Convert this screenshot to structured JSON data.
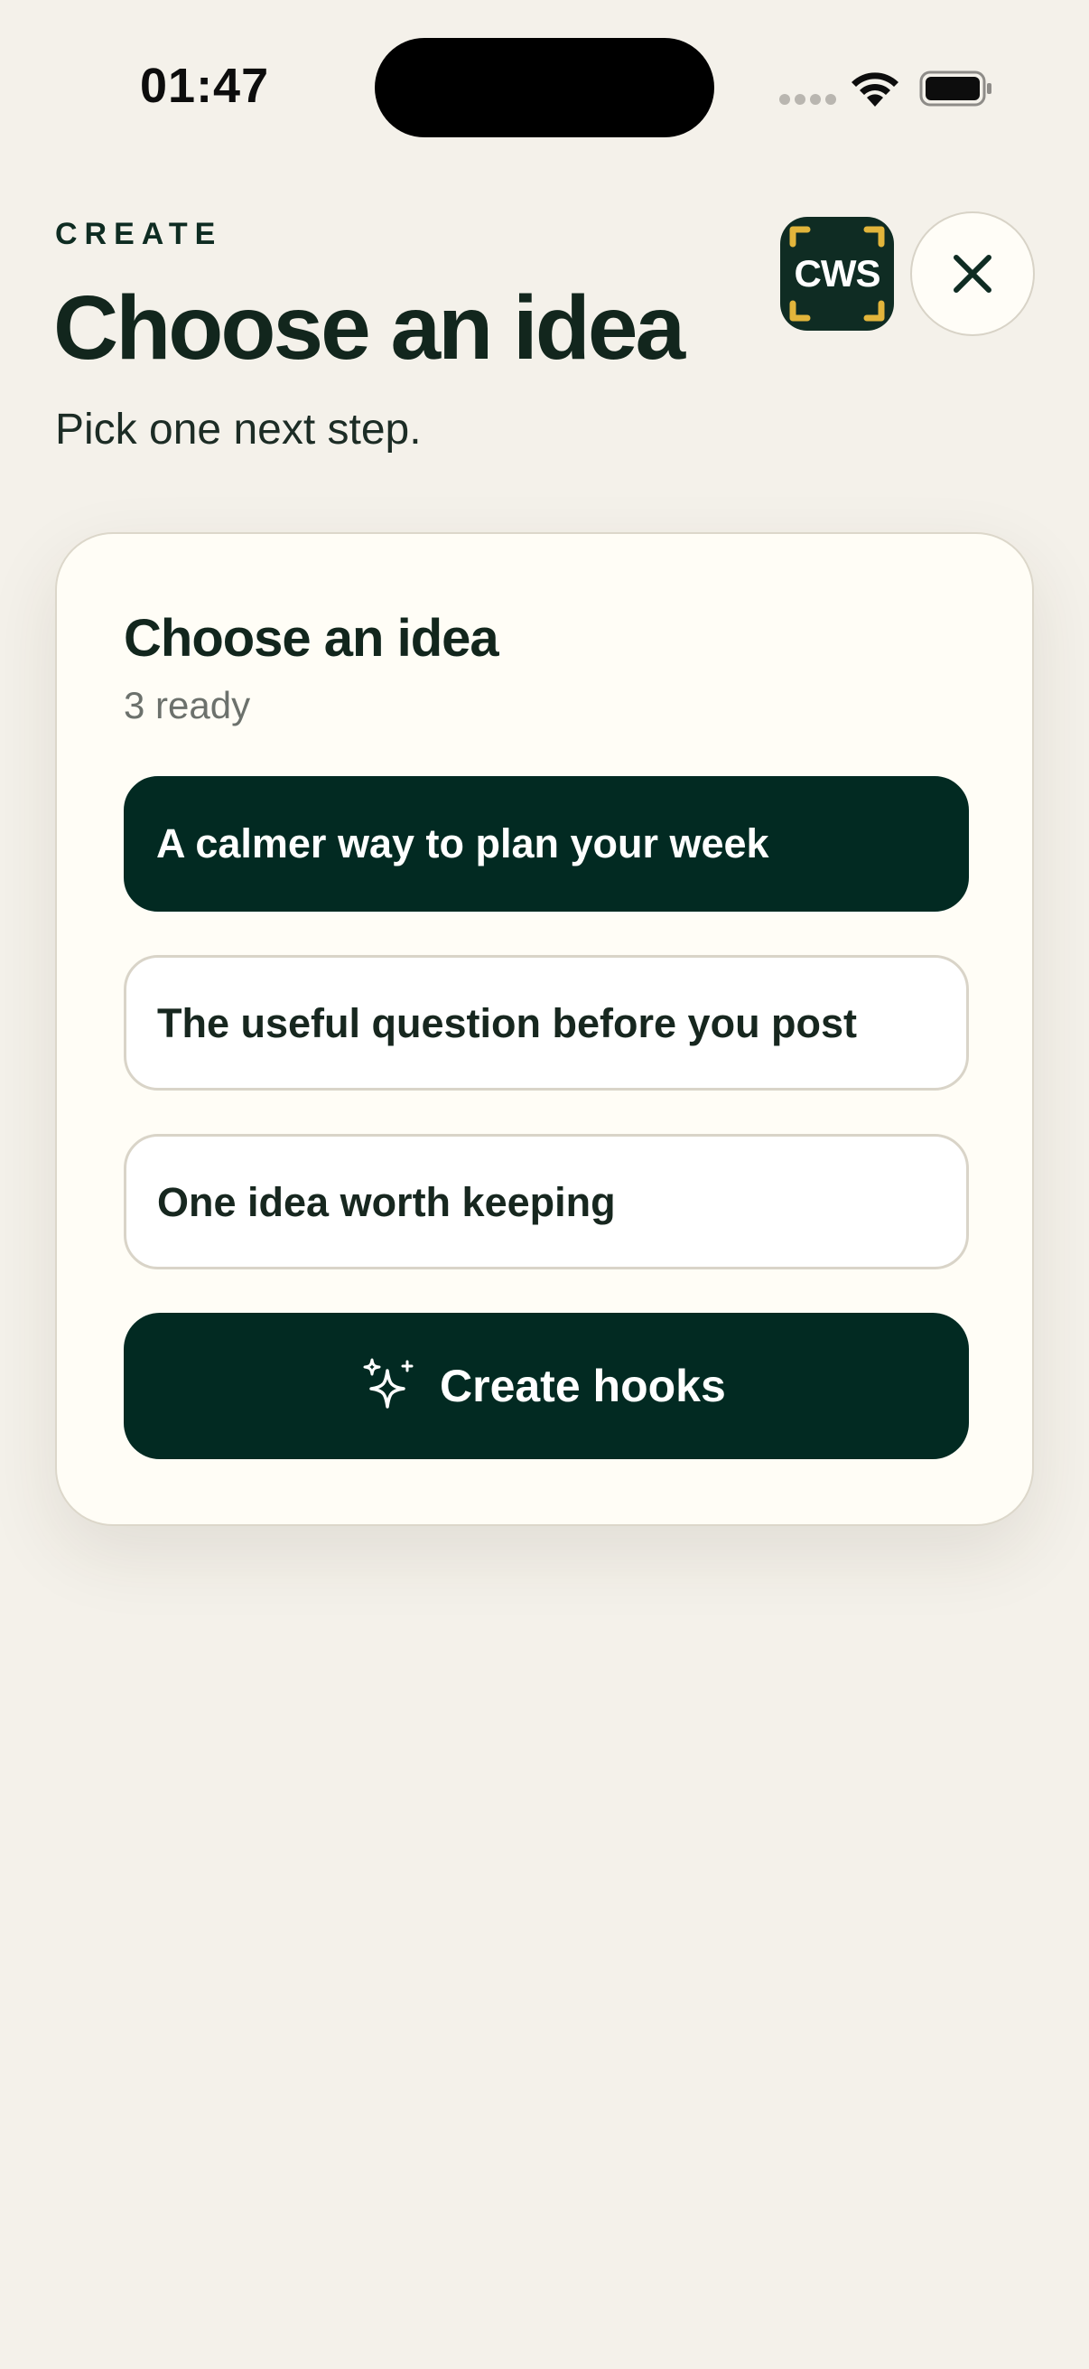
{
  "status_bar": {
    "time": "01:47"
  },
  "header": {
    "eyebrow": "CREATE",
    "title": "Choose an idea",
    "subtitle": "Pick one next step.",
    "logo_text": "CWS",
    "close_icon": "close-icon"
  },
  "card": {
    "title": "Choose an idea",
    "count_label": "3 ready",
    "ideas": [
      {
        "label": "A calmer way to plan your week",
        "selected": true
      },
      {
        "label": "The useful question before you post",
        "selected": false
      },
      {
        "label": "One idea worth keeping",
        "selected": false
      }
    ],
    "primary_action": {
      "label": "Create hooks",
      "icon": "sparkle-icon"
    }
  },
  "colors": {
    "background": "#f4f1ea",
    "card_background": "#fffdf6",
    "accent_dark": "#022a22",
    "logo_bracket": "#e2b53b",
    "text_primary": "#12261d",
    "text_muted": "#6c716c"
  }
}
